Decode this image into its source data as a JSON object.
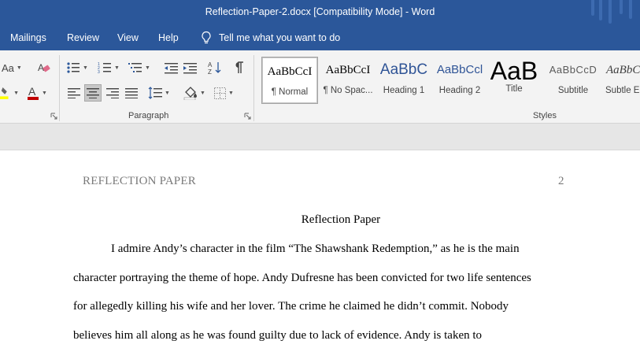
{
  "window": {
    "title": "Reflection-Paper-2.docx [Compatibility Mode]  -  Word"
  },
  "menu": {
    "tabs": [
      "Mailings",
      "Review",
      "View",
      "Help"
    ],
    "tell_me": "Tell me what you want to do"
  },
  "ribbon": {
    "font_group": {
      "change_case_label": "Aa",
      "clear_formatting_icon": "eraser-icon",
      "highlight_color": "#ffff00",
      "font_color": "#c00000"
    },
    "paragraph_group": {
      "label": "Paragraph",
      "active_alignment": "center"
    },
    "styles_group": {
      "label": "Styles",
      "items": [
        {
          "sample": "AaBbCcI",
          "name": "¶ Normal"
        },
        {
          "sample": "AaBbCcI",
          "name": "¶ No Spac..."
        },
        {
          "sample": "AaBbC",
          "name": "Heading 1"
        },
        {
          "sample": "AaBbCcl",
          "name": "Heading 2"
        },
        {
          "sample": "AaB",
          "name": "Title"
        },
        {
          "sample": "AaBbCcD",
          "name": "Subtitle"
        },
        {
          "sample": "AaBbCc",
          "name": "Subtle Em"
        }
      ]
    }
  },
  "document": {
    "running_head": "REFLECTION PAPER",
    "page_number": "2",
    "heading": "Reflection Paper",
    "lines": [
      "I admire Andy’s character in the film “The Shawshank Redemption,” as he is the main",
      "character portraying the theme of hope. Andy Dufresne has been convicted for two life sentences",
      "for allegedly killing his wife and her lover. The crime he claimed he didn’t commit. Nobody",
      "believes him all along as he was found guilty due to lack of evidence. Andy is taken to"
    ]
  },
  "colors": {
    "title_bar": "#2b579a",
    "ribbon_bg": "#f3f3f3",
    "heading_blue": "#2f5496"
  }
}
